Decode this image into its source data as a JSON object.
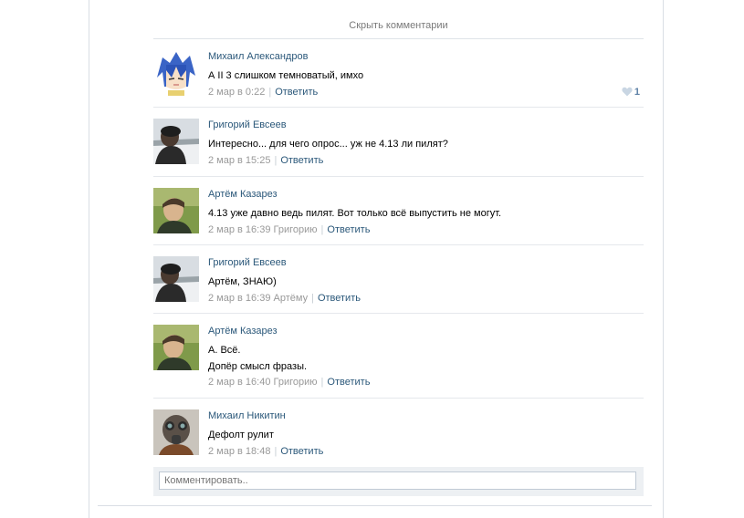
{
  "hide_comments_label": "Скрыть комментарии",
  "comments": [
    {
      "author": "Михаил Александров",
      "lines": [
        "А II 3 слишком темноватый, имхо"
      ],
      "date": "2 мар в 0:22",
      "to": "",
      "reply_label": "Ответить",
      "likes": "1"
    },
    {
      "author": "Григорий Евсеев",
      "lines": [
        "Интересно... для чего опрос... уж не 4.13 ли пилят?"
      ],
      "date": "2 мар в 15:25",
      "to": "",
      "reply_label": "Ответить"
    },
    {
      "author": "Артём Казарез",
      "lines": [
        "4.13 уже давно ведь пилят. Вот только всё выпустить не могут."
      ],
      "date": "2 мар в 16:39",
      "to": "Григорию",
      "reply_label": "Ответить"
    },
    {
      "author": "Григорий Евсеев",
      "lines": [
        "Артём, ЗНАЮ)"
      ],
      "date": "2 мар в 16:39",
      "to": "Артёму",
      "reply_label": "Ответить"
    },
    {
      "author": "Артём Казарез",
      "lines": [
        "А. Всё.",
        "Допёр смысл фразы."
      ],
      "date": "2 мар в 16:40",
      "to": "Григорию",
      "reply_label": "Ответить"
    },
    {
      "author": "Михаил Никитин",
      "lines": [
        "Дефолт рулит"
      ],
      "date": "2 мар в 18:48",
      "to": "",
      "reply_label": "Ответить"
    }
  ],
  "reply_box": {
    "placeholder": "Комментировать.."
  },
  "colors": {
    "link": "#2b587a",
    "meta": "#999999",
    "reply_bg": "#edf0f3"
  }
}
